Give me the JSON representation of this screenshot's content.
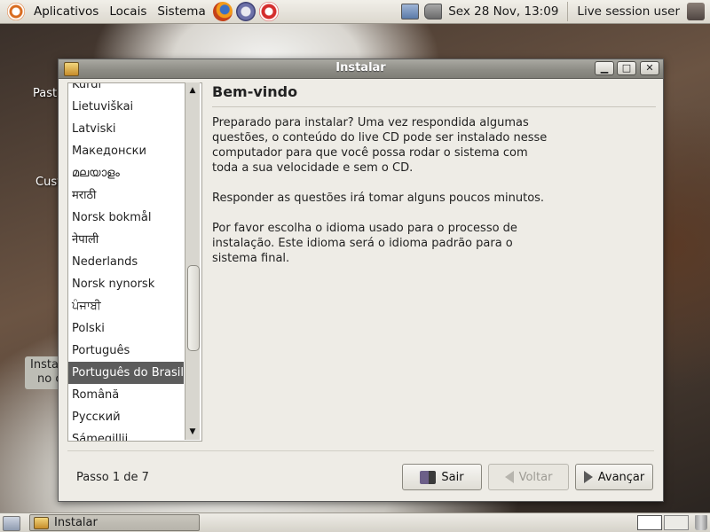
{
  "top_panel": {
    "menus": [
      "Aplicativos",
      "Locais",
      "Sistema"
    ],
    "clock": "Sex 28 Nov, 13:09",
    "user": "Live session user"
  },
  "desktop": {
    "icon_labels": [
      "Past",
      "Cust"
    ],
    "install_icon_lines": [
      "Insta",
      "no c"
    ]
  },
  "window": {
    "title": "Instalar",
    "languages": [
      "Kurdî",
      "Lietuviškai",
      "Latviski",
      "Македонски",
      "മലയാളം",
      "मराठी",
      "Norsk bokmål",
      "नेपाली",
      "Nederlands",
      "Norsk nynorsk",
      "ਪੰਜਾਬੀ",
      "Polski",
      "Português",
      "Português do Brasil",
      "Română",
      "Русский",
      "Sámegillii"
    ],
    "selected_language": "Português do Brasil",
    "heading": "Bem-vindo",
    "paragraphs": [
      "Preparado para instalar? Uma vez respondida algumas\nquestões, o conteúdo do live CD pode ser instalado nesse\ncomputador para que você possa rodar o sistema com\ntoda a sua velocidade e sem o CD.",
      "Responder as questões irá tomar alguns poucos minutos.",
      "Por favor escolha o idioma usado para o processo de\ninstalação. Este idioma será o idioma padrão para o\nsistema final."
    ],
    "step": "Passo 1 de 7",
    "buttons": {
      "quit": "Sair",
      "back": "Voltar",
      "forward": "Avançar"
    }
  },
  "taskbar": {
    "task_label": "Instalar"
  }
}
